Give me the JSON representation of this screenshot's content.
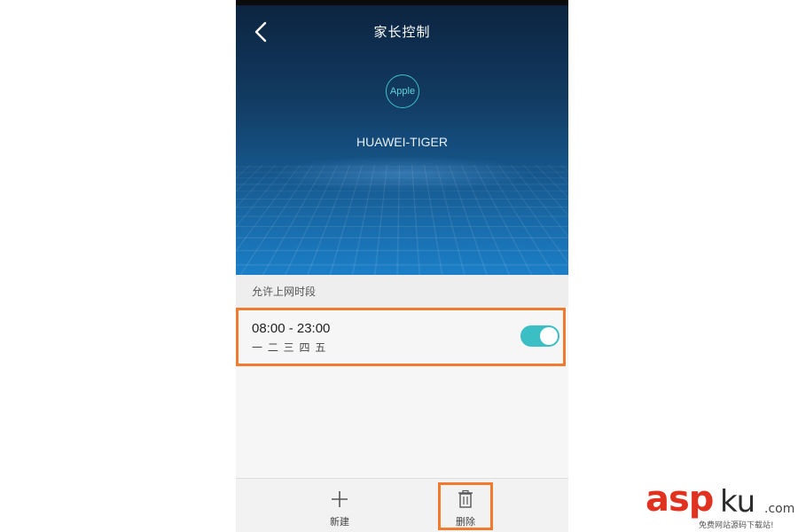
{
  "header": {
    "title": "家长控制",
    "back_icon": "chevron-left-icon"
  },
  "device": {
    "brand": "Apple",
    "name": "HUAWEI-TIGER"
  },
  "section": {
    "label": "允许上网时段"
  },
  "schedule": {
    "time_range": "08:00 - 23:00",
    "days": "一 二 三 四 五",
    "enabled": true
  },
  "toolbar": {
    "new_label": "新建",
    "new_icon": "plus-icon",
    "delete_label": "删除",
    "delete_icon": "trash-icon"
  },
  "watermark": {
    "brand_part1": "asp",
    "brand_part2": "ku",
    "domain": ".com",
    "tagline": "免费网站源码下载站!"
  },
  "colors": {
    "accent_teal": "#3bbfc4",
    "highlight_orange": "#f07a2e",
    "hero_top": "#0c2440",
    "hero_bottom": "#1b7fc8",
    "watermark_red": "#e0321e"
  }
}
